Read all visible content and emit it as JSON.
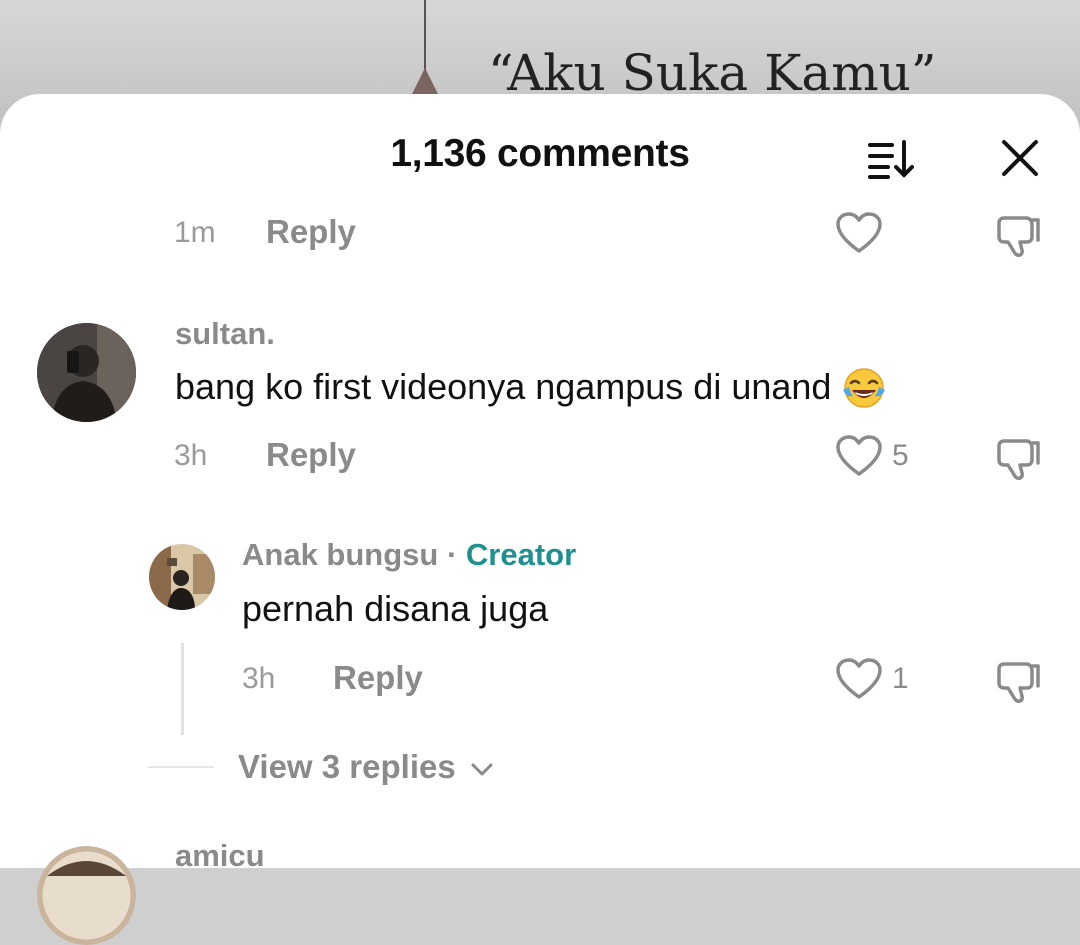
{
  "background": {
    "video_title": "“Aku Suka Kamu”"
  },
  "header": {
    "title": "1,136 comments",
    "sort_icon": "sort-icon",
    "close_icon": "close-icon"
  },
  "comments": [
    {
      "time": "1m",
      "reply_label": "Reply"
    },
    {
      "username": "sultan.",
      "text": "bang ko first videonya ngampus di unand",
      "emoji": "face-with-tears-of-joy",
      "time": "3h",
      "reply_label": "Reply",
      "likes": "5"
    },
    {
      "username": "Anak bungsu",
      "separator": "·",
      "badge": "Creator",
      "text": "pernah disana juga",
      "time": "3h",
      "reply_label": "Reply",
      "likes": "1"
    }
  ],
  "view_replies": "View 3 replies",
  "next_comment": {
    "username": "amicu"
  },
  "colors": {
    "creator_badge": "#1f8f8f",
    "muted_text": "#8a8a8a",
    "primary_text": "#111111"
  }
}
